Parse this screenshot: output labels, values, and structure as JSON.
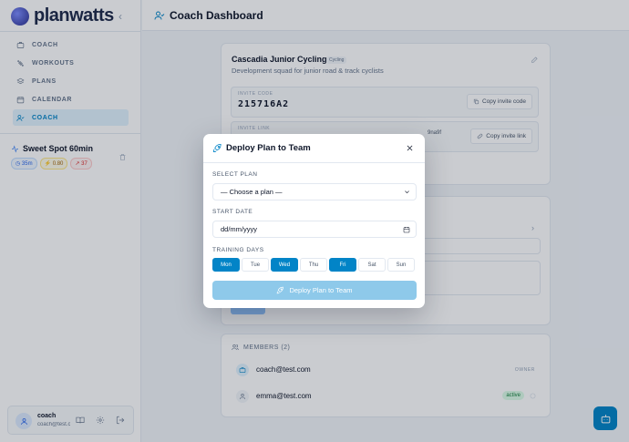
{
  "app": {
    "name": "planwatts",
    "collapse_glyph": "‹"
  },
  "sidebar": {
    "items": [
      {
        "label": "COACH",
        "icon": "briefcase-icon"
      },
      {
        "label": "WORKOUTS",
        "icon": "dumbbell-icon"
      },
      {
        "label": "PLANS",
        "icon": "layers-icon"
      },
      {
        "label": "CALENDAR",
        "icon": "calendar-icon"
      },
      {
        "label": "COACH",
        "icon": "user-check-icon",
        "active": true
      }
    ],
    "workout": {
      "title": "Sweet Spot 60min",
      "duration": "35m",
      "intensity": "0.80",
      "tss": "37"
    },
    "user": {
      "name": "coach",
      "email": "coach@test.com"
    }
  },
  "header": {
    "title": "Coach Dashboard"
  },
  "team": {
    "name": "Cascadia Junior Cycling",
    "tag": "Cycling",
    "description": "Development squad for junior road & track cyclists",
    "invite_code_label": "INVITE CODE",
    "invite_code": "215716A2",
    "copy_code_label": "Copy invite code",
    "invite_link_label": "INVITE LINK",
    "invite_link_fragment": "9na9f",
    "copy_link_label": "Copy invite link"
  },
  "members": {
    "header": "MEMBERS (2)",
    "list": [
      {
        "email": "coach@test.com",
        "role": "OWNER"
      },
      {
        "email": "emma@test.com",
        "status": "active"
      }
    ]
  },
  "modal": {
    "title": "Deploy Plan to Team",
    "select_plan_label": "SELECT PLAN",
    "select_plan_value": "— Choose a plan —",
    "start_date_label": "START DATE",
    "start_date_placeholder": "dd/mm/yyyy",
    "training_days_label": "TRAINING DAYS",
    "days": [
      {
        "label": "Mon",
        "selected": true
      },
      {
        "label": "Tue",
        "selected": false
      },
      {
        "label": "Wed",
        "selected": true
      },
      {
        "label": "Thu",
        "selected": false
      },
      {
        "label": "Fri",
        "selected": true
      },
      {
        "label": "Sat",
        "selected": false
      },
      {
        "label": "Sun",
        "selected": false
      }
    ],
    "deploy_label": "Deploy Plan to Team"
  },
  "colors": {
    "accent": "#0284c7",
    "accent_light": "#8ec9ea",
    "active_badge": "#15803d"
  }
}
